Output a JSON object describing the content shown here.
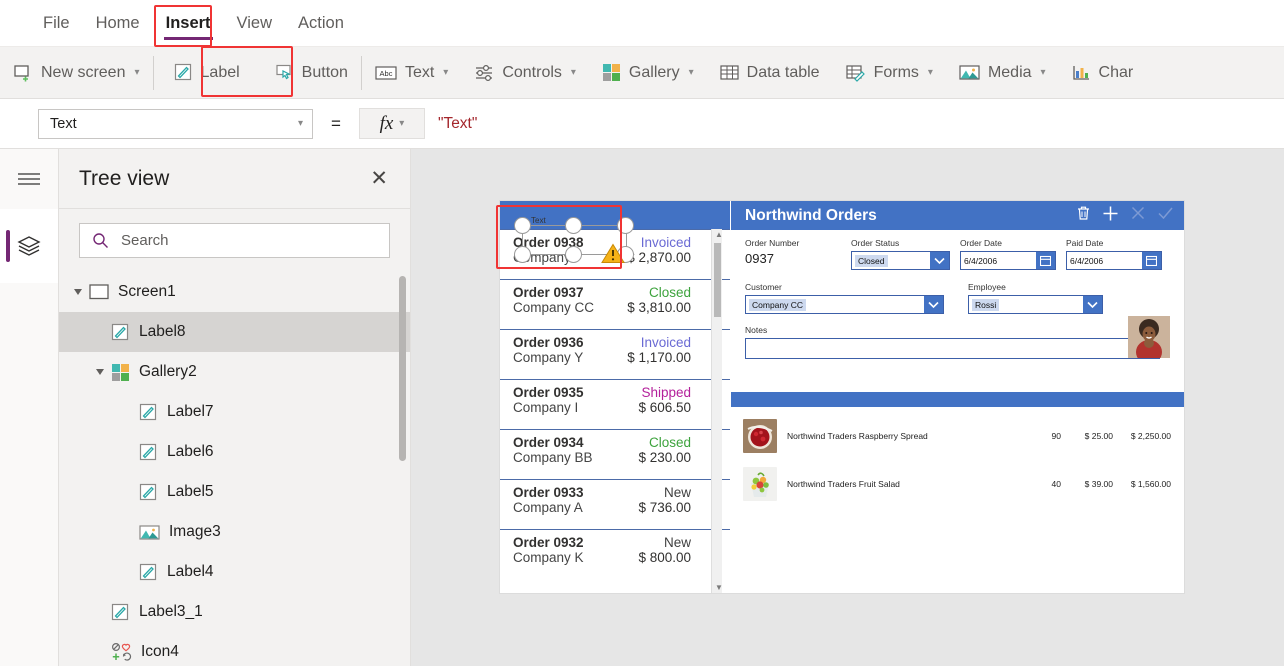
{
  "menu": {
    "tabs": [
      {
        "label": "File",
        "active": false
      },
      {
        "label": "Home",
        "active": false
      },
      {
        "label": "Insert",
        "active": true
      },
      {
        "label": "View",
        "active": false
      },
      {
        "label": "Action",
        "active": false
      }
    ]
  },
  "ribbon": {
    "items": [
      {
        "label": "New screen",
        "icon": "new-screen-icon",
        "caret": true,
        "highlighted": false
      },
      {
        "label": "Label",
        "icon": "label-icon",
        "caret": false,
        "highlighted": true
      },
      {
        "label": "Button",
        "icon": "button-icon",
        "caret": false,
        "highlighted": false
      },
      {
        "label": "Text",
        "icon": "text-abc-icon",
        "caret": true,
        "highlighted": false
      },
      {
        "label": "Controls",
        "icon": "controls-sliders-icon",
        "caret": true,
        "highlighted": false
      },
      {
        "label": "Gallery",
        "icon": "gallery-squares-icon",
        "caret": true,
        "highlighted": false
      },
      {
        "label": "Data table",
        "icon": "data-table-icon",
        "caret": false,
        "highlighted": false
      },
      {
        "label": "Forms",
        "icon": "forms-icon",
        "caret": true,
        "highlighted": false
      },
      {
        "label": "Media",
        "icon": "media-image-icon",
        "caret": true,
        "highlighted": false
      },
      {
        "label": "Char",
        "icon": "charts-bar-icon",
        "caret": false,
        "highlighted": false
      }
    ]
  },
  "formula_bar": {
    "property": "Text",
    "equals": "=",
    "fx_label": "fx",
    "value": "\"Text\""
  },
  "left_rail": {
    "menu_icon": "hamburger-menu-icon",
    "tree_icon": "layers-tree-icon"
  },
  "tree_view": {
    "title": "Tree view",
    "close_icon": "close-icon",
    "search_placeholder": "Search",
    "search_icon": "search-icon",
    "items": [
      {
        "label": "Screen1",
        "icon": "screen-icon",
        "indent": 0,
        "expandable": true,
        "selected": false
      },
      {
        "label": "Label8",
        "icon": "label-icon",
        "indent": 1,
        "expandable": false,
        "selected": true
      },
      {
        "label": "Gallery2",
        "icon": "gallery-icon",
        "indent": 1,
        "expandable": true,
        "selected": false
      },
      {
        "label": "Label7",
        "icon": "label-icon",
        "indent": 2,
        "expandable": false,
        "selected": false
      },
      {
        "label": "Label6",
        "icon": "label-icon",
        "indent": 2,
        "expandable": false,
        "selected": false
      },
      {
        "label": "Label5",
        "icon": "label-icon",
        "indent": 2,
        "expandable": false,
        "selected": false
      },
      {
        "label": "Image3",
        "icon": "image-icon",
        "indent": 2,
        "expandable": false,
        "selected": false
      },
      {
        "label": "Label4",
        "icon": "label-icon",
        "indent": 2,
        "expandable": false,
        "selected": false
      },
      {
        "label": "Label3_1",
        "icon": "label-icon",
        "indent": 1,
        "expandable": false,
        "selected": false
      },
      {
        "label": "Icon4",
        "icon": "icon-set-icon",
        "indent": 1,
        "expandable": false,
        "selected": false
      }
    ]
  },
  "canvas": {
    "selection": {
      "tag": "Text",
      "warning_icon": "warning-triangle-icon",
      "handles": 6
    },
    "gallery": {
      "items": [
        {
          "order": "Order 0938",
          "company": "Company I",
          "status": "Invoiced",
          "status_color": "#6a6ad4",
          "amount": "$ 2,870.00"
        },
        {
          "order": "Order 0937",
          "company": "Company CC",
          "status": "Closed",
          "status_color": "#3da33d",
          "amount": "$ 3,810.00"
        },
        {
          "order": "Order 0936",
          "company": "Company Y",
          "status": "Invoiced",
          "status_color": "#6a6ad4",
          "amount": "$ 1,170.00"
        },
        {
          "order": "Order 0935",
          "company": "Company I",
          "status": "Shipped",
          "status_color": "#b4209b",
          "amount": "$ 606.50"
        },
        {
          "order": "Order 0934",
          "company": "Company BB",
          "status": "Closed",
          "status_color": "#3da33d",
          "amount": "$ 230.00"
        },
        {
          "order": "Order 0933",
          "company": "Company A",
          "status": "New",
          "status_color": "#3f3f3f",
          "amount": "$ 736.00"
        },
        {
          "order": "Order 0932",
          "company": "Company K",
          "status": "New",
          "status_color": "#3f3f3f",
          "amount": "$ 800.00"
        }
      ],
      "chevron_icon": "chevron-right-icon"
    },
    "detail": {
      "title": "Northwind Orders",
      "header_icons": [
        {
          "name": "delete-icon",
          "enabled": true
        },
        {
          "name": "add-icon",
          "enabled": true
        },
        {
          "name": "cancel-icon",
          "enabled": false
        },
        {
          "name": "save-icon",
          "enabled": false
        }
      ],
      "fields": [
        {
          "label": "Order Number",
          "value": "0937",
          "type": "readonly"
        },
        {
          "label": "Order Status",
          "value": "Closed",
          "type": "dropdown"
        },
        {
          "label": "Order Date",
          "value": "6/4/2006",
          "type": "date"
        },
        {
          "label": "Paid Date",
          "value": "6/4/2006",
          "type": "date"
        },
        {
          "label": "Customer",
          "value": "Company CC",
          "type": "dropdown"
        },
        {
          "label": "Employee",
          "value": "Rossi",
          "type": "dropdown"
        },
        {
          "label": "Notes",
          "value": "",
          "type": "textarea"
        }
      ],
      "employee_photo": "employee-avatar",
      "line_items": [
        {
          "product": "Northwind Traders Raspberry Spread",
          "qty": "90",
          "price": "$ 25.00",
          "total": "$ 2,250.00",
          "thumb": "raspberry-spread-thumb"
        },
        {
          "product": "Northwind Traders Fruit Salad",
          "qty": "40",
          "price": "$ 39.00",
          "total": "$ 1,560.00",
          "thumb": "fruit-salad-thumb"
        }
      ]
    }
  },
  "colors": {
    "accent_purple": "#742774",
    "app_blue": "#4272c4",
    "highlight_red": "#f03434",
    "formula_red": "#a4262c"
  }
}
